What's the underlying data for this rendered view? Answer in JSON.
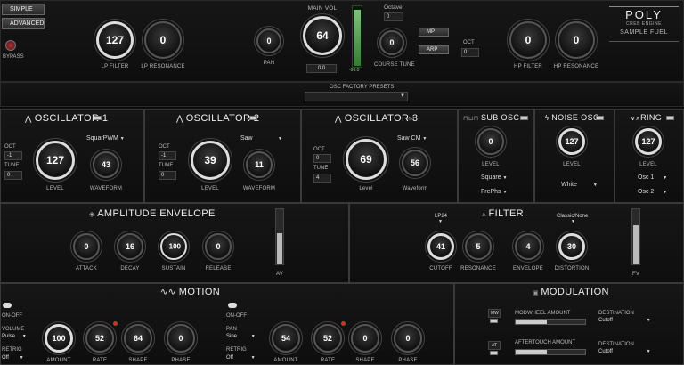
{
  "mode_buttons": {
    "simple": "SIMPLE",
    "advanced": "ADVANCED",
    "bypass": "BYPASS"
  },
  "top": {
    "lp_filter": {
      "label": "LP FILTER",
      "value": "127"
    },
    "lp_resonance": {
      "label": "LP RESONANCE",
      "value": "0"
    },
    "pan": {
      "label": "PAN",
      "value": "0"
    },
    "main_vol": {
      "label": "MAIN VOL",
      "value": "64",
      "readout": "0.0",
      "meter_db": "-96.0"
    },
    "octave": {
      "label": "Octave",
      "value": "0"
    },
    "coarse_tune": {
      "label": "COURSE TUNE",
      "value": "0"
    },
    "mp_label": "MP",
    "arp_label": "ARP",
    "oct": {
      "label": "OCT",
      "value": "0"
    },
    "hp_filter": {
      "label": "HP FILTER",
      "value": "0"
    },
    "hp_resonance": {
      "label": "HP RESONANCE",
      "value": "0"
    },
    "brand_title": "POLY",
    "brand_sub": "CREB ENGINE",
    "brand_company": "SAMPLE FUEL"
  },
  "presets": {
    "label": "OSC FACTORY PRESETS",
    "value": ""
  },
  "osc1": {
    "title": "OSCILLATOR 1",
    "waveform_select": "SquarPWM",
    "oct_label": "OCT",
    "oct": "-1",
    "tune_label": "TUNE",
    "tune": "0",
    "level": {
      "label": "LEVEL",
      "value": "127"
    },
    "waveform": {
      "label": "WAVEFORM",
      "value": "43"
    }
  },
  "osc2": {
    "title": "OSCILLATOR 2",
    "waveform_select": "Saw",
    "oct_label": "OCT",
    "oct": "-1",
    "tune_label": "TUNE",
    "tune": "0",
    "level": {
      "label": "LEVEL",
      "value": "39"
    },
    "waveform": {
      "label": "WAVEFORM",
      "value": "11"
    }
  },
  "osc3": {
    "title": "OSCILLATOR 3",
    "waveform_select": "Saw CM",
    "oct_label": "OCT",
    "oct": "0",
    "tune_label": "TUNE",
    "tune": "4",
    "level": {
      "label": "Level",
      "value": "69"
    },
    "waveform": {
      "label": "Waveform",
      "value": "56"
    }
  },
  "sub_osc": {
    "title": "SUB OSC",
    "level": {
      "label": "LEVEL",
      "value": "0"
    },
    "shape": "Square",
    "mode": "FrePhs"
  },
  "noise_osc": {
    "title": "NOISE OSC",
    "level": {
      "label": "LEVEL",
      "value": "127"
    },
    "type": "White"
  },
  "ring": {
    "title": "RING",
    "level": {
      "label": "LEVEL",
      "value": "127"
    },
    "src1": "Osc 1",
    "src2": "Osc 2"
  },
  "amp_env": {
    "title": "AMPLITUDE ENVELOPE",
    "knobs": [
      {
        "label": "ATTACK",
        "value": "0"
      },
      {
        "label": "DECAY",
        "value": "16"
      },
      {
        "label": "SUSTAIN",
        "value": "-100"
      },
      {
        "label": "RELEASE",
        "value": "0"
      }
    ],
    "av_label": "AV"
  },
  "filter": {
    "title": "FILTER",
    "type_select": "LP24",
    "mode_select": "Classic/None",
    "knobs": [
      {
        "label": "CUTOFF",
        "value": "41"
      },
      {
        "label": "RESONANCE",
        "value": "5"
      },
      {
        "label": "ENVELOPE",
        "value": "4"
      },
      {
        "label": "DISTORTION",
        "value": "30"
      }
    ],
    "fv_label": "FV"
  },
  "motion": {
    "title": "MOTION",
    "left": {
      "onoff": "ON-OFF",
      "dest_label": "VOLUME",
      "dest": "Pulse",
      "retrig_label": "RETRIG",
      "retrig": "Off"
    },
    "right": {
      "onoff": "ON-OFF",
      "dest_label": "PAN",
      "dest": "Sine",
      "retrig_label": "RETRIG",
      "retrig": "Off"
    },
    "knobs_left": [
      {
        "label": "AMOUNT",
        "value": "100"
      },
      {
        "label": "RATE",
        "value": "52"
      },
      {
        "label": "SHAPE",
        "value": "64"
      },
      {
        "label": "PHASE",
        "value": "0"
      }
    ],
    "knobs_right": [
      {
        "label": "AMOUNT",
        "value": "54"
      },
      {
        "label": "RATE",
        "value": "52"
      },
      {
        "label": "SHAPE",
        "value": "0"
      },
      {
        "label": "PHASE",
        "value": "0"
      }
    ]
  },
  "modulation": {
    "title": "MODULATION",
    "rows": [
      {
        "tag": "MW",
        "label": "MODWHEEL AMOUNT",
        "amount": 0.45,
        "dest_label": "DESTINATION",
        "dest": "Cutoff"
      },
      {
        "tag": "AT",
        "label": "AFTERTOUCH AMOUNT",
        "amount": 0.45,
        "dest_label": "DESTINATION",
        "dest": "Cutoff"
      }
    ]
  },
  "levels": {
    "meter": 0.92,
    "av": 0.55,
    "fv": 0.7
  }
}
